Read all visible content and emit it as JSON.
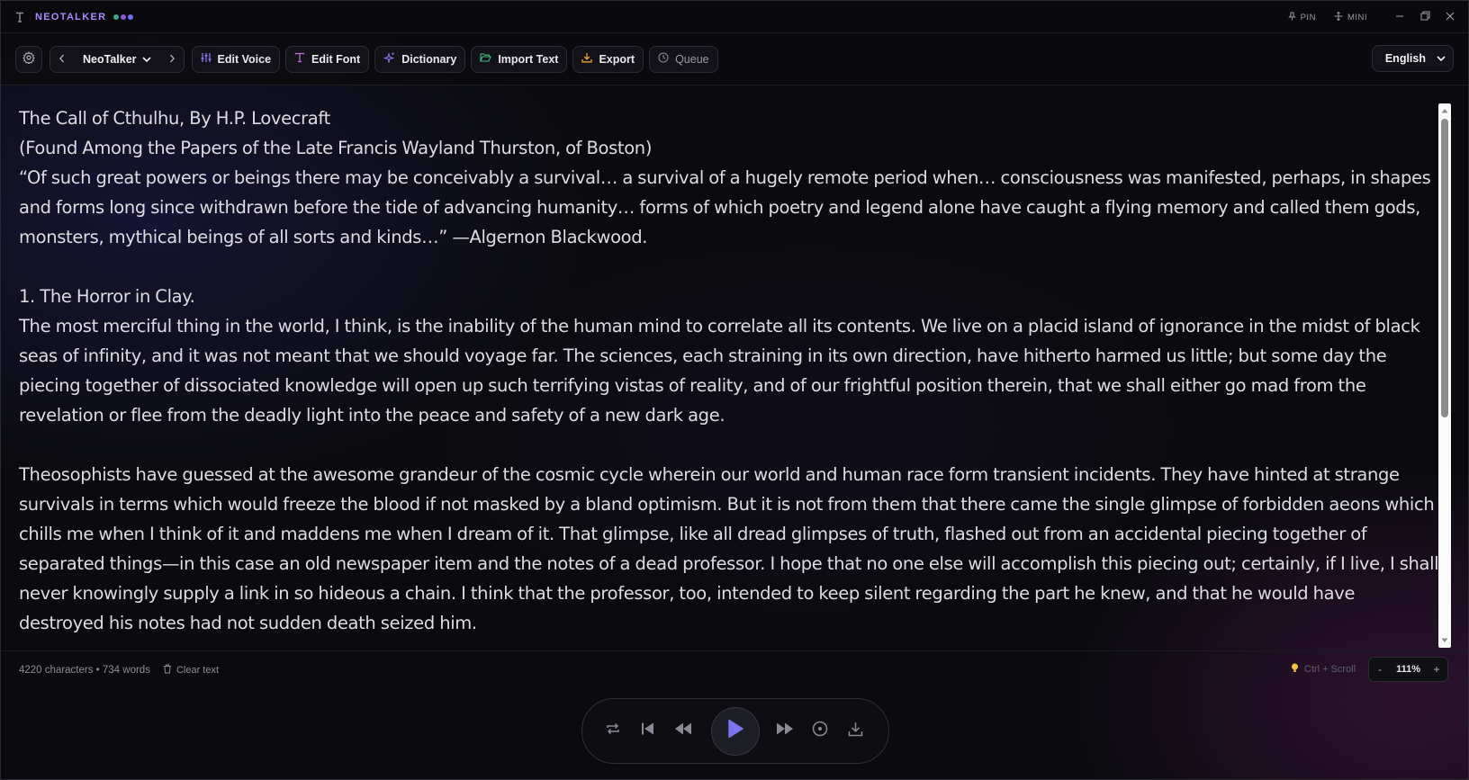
{
  "app": {
    "title": "NEOTALKER",
    "dot_colors": [
      "#3aa38a",
      "#8a5ad6",
      "#6e6ef0"
    ],
    "accent": "#a98bff"
  },
  "titlebar": {
    "pin_label": "PIN",
    "mini_label": "MINI"
  },
  "toolbar": {
    "voice_name": "NeoTalker",
    "edit_voice": "Edit Voice",
    "edit_font": "Edit Font",
    "dictionary": "Dictionary",
    "import_text": "Import Text",
    "export": "Export",
    "queue": "Queue",
    "language": "English"
  },
  "document": {
    "paragraphs": [
      "The Call of Cthulhu, By H.P. Lovecraft",
      "(Found Among the Papers of the Late Francis Wayland Thurston, of Boston)",
      "“Of such great powers or beings there may be conceivably a survival… a survival of a hugely remote period when… consciousness was manifested, perhaps, in shapes and forms long since withdrawn before the tide of advancing humanity… forms of which poetry and legend alone have caught a flying memory and called them gods, monsters, mythical beings of all sorts and kinds…” —Algernon Blackwood.",
      "",
      "1. The Horror in Clay.",
      "The most merciful thing in the world, I think, is the inability of the human mind to correlate all its contents. We live on a placid island of ignorance in the midst of black seas of infinity, and it was not meant that we should voyage far. The sciences, each straining in its own direction, have hitherto harmed us little; but some day the piecing together of dissociated knowledge will open up such terrifying vistas of reality, and of our frightful position therein, that we shall either go mad from the revelation or flee from the deadly light into the peace and safety of a new dark age.",
      "",
      "Theosophists have guessed at the awesome grandeur of the cosmic cycle wherein our world and human race form transient incidents. They have hinted at strange survivals in terms which would freeze the blood if not masked by a bland optimism. But it is not from them that there came the single glimpse of forbidden aeons which chills me when I think of it and maddens me when I dream of it. That glimpse, like all dread glimpses of truth, flashed out from an accidental piecing together of separated things—in this case an old newspaper item and the notes of a dead professor. I hope that no one else will accomplish this piecing out; certainly, if I live, I shall never knowingly supply a link in so hideous a chain. I think that the professor, too, intended to keep silent regarding the part he knew, and that he would have destroyed his notes had not sudden death seized him."
    ]
  },
  "status": {
    "counts": "4220 characters • 734 words",
    "clear_text": "Clear text",
    "hint": "Ctrl + Scroll",
    "zoom_minus": "-",
    "zoom_value": "111%",
    "zoom_plus": "+"
  },
  "player": {
    "icons": [
      "repeat-icon",
      "skip-previous-icon",
      "rewind-icon",
      "play-icon",
      "fast-forward-icon",
      "stop-circle-icon",
      "download-icon"
    ],
    "play_color": "#7b74f0"
  }
}
